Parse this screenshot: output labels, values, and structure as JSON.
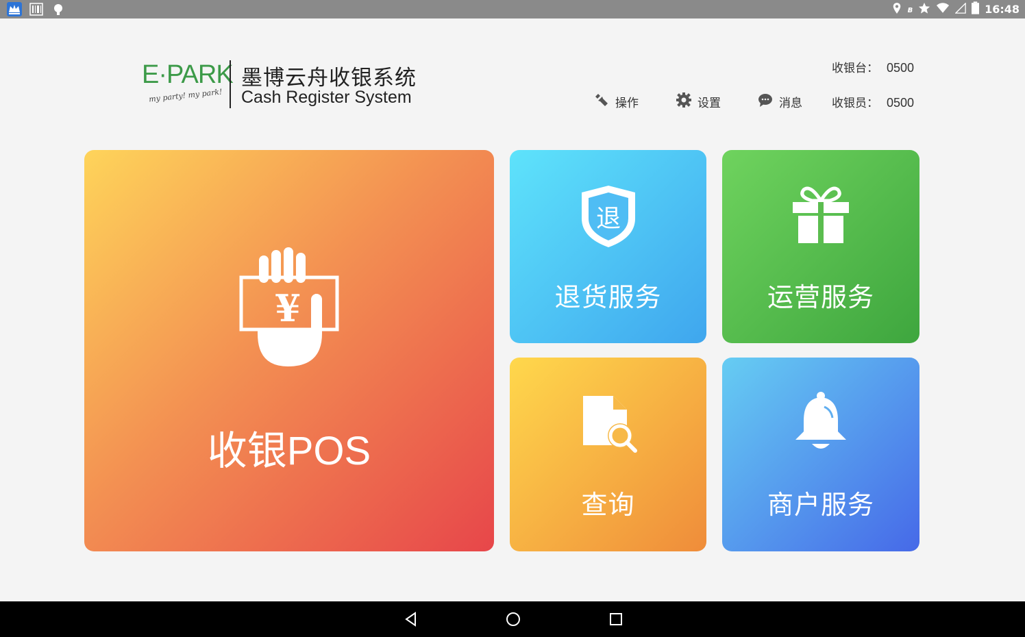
{
  "status_bar": {
    "time": "16:48",
    "left_icons": [
      "crown-app-icon",
      "barcode-icon",
      "android-icon"
    ],
    "right_icons": [
      "location-icon",
      "bluetooth-icon",
      "star-icon",
      "wifi-icon",
      "signal-icon",
      "battery-icon"
    ]
  },
  "header": {
    "logo_brand": "E·PARK",
    "logo_tagline": "my party! my park!",
    "title_cn": "墨博云舟收银系统",
    "title_en": "Cash Register System",
    "menu": [
      {
        "label": "操作",
        "icon": "wrench-icon"
      },
      {
        "label": "设置",
        "icon": "gear-icon"
      },
      {
        "label": "消息",
        "icon": "chat-icon"
      }
    ],
    "register_label": "收银台：",
    "register_value": "0500",
    "cashier_label": "收银员：",
    "cashier_value": "0500"
  },
  "tiles": {
    "pos": {
      "label": "收银POS",
      "icon": "cash-hand-icon"
    },
    "return": {
      "label": "退货服务",
      "icon": "return-shield-icon",
      "icon_text": "退"
    },
    "ops": {
      "label": "运营服务",
      "icon": "gift-icon"
    },
    "query": {
      "label": "查询",
      "icon": "document-search-icon"
    },
    "merchant": {
      "label": "商户服务",
      "icon": "bell-icon"
    }
  },
  "colors": {
    "status_bar": "#8a8a8a",
    "brand_green": "#3c9a48",
    "background": "#f4f4f4"
  }
}
